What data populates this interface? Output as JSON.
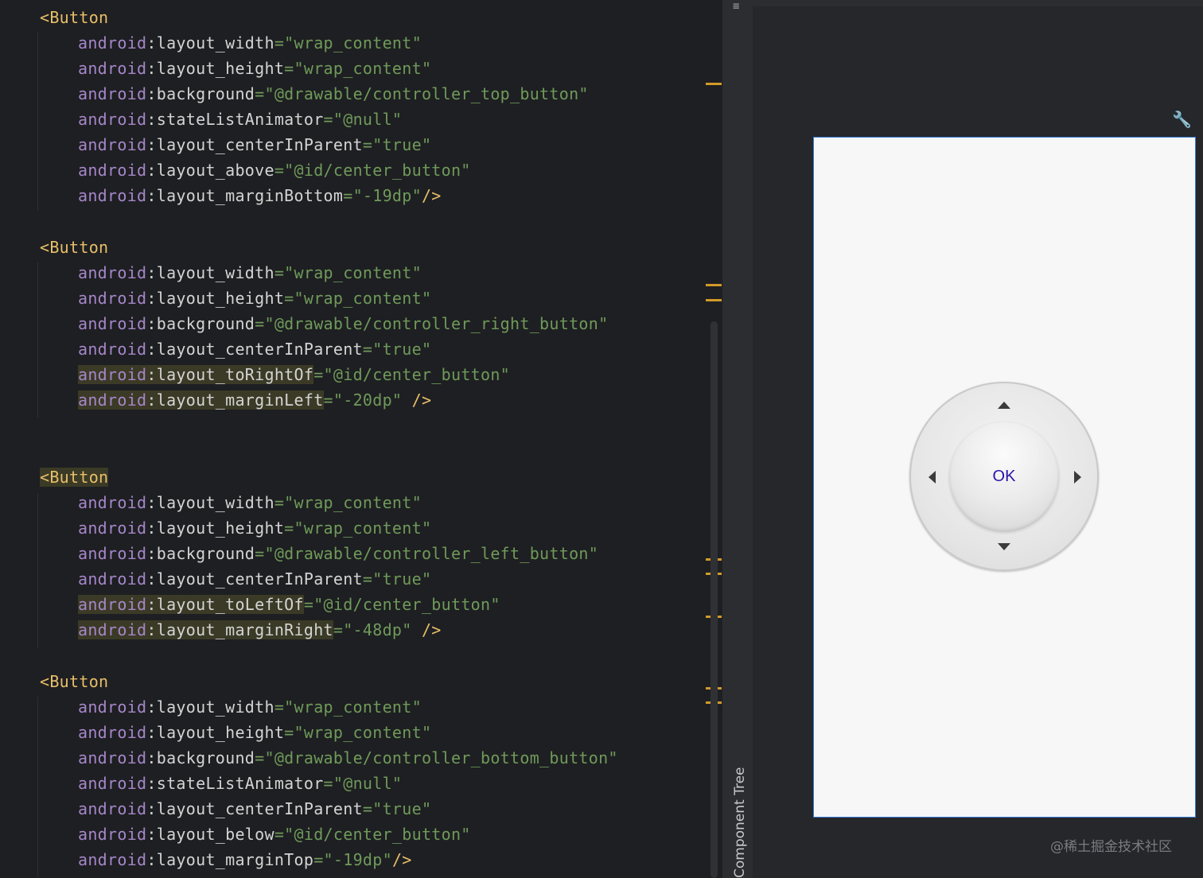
{
  "editor": {
    "lines": [
      {
        "tag": "<Button"
      },
      {
        "ns": "android",
        "attr": "layout_width",
        "val": "\"wrap_content\""
      },
      {
        "ns": "android",
        "attr": "layout_height",
        "val": "\"wrap_content\""
      },
      {
        "ns": "android",
        "attr": "background",
        "val": "\"@drawable/controller_top_button\""
      },
      {
        "ns": "android",
        "attr": "stateListAnimator",
        "val": "\"@null\""
      },
      {
        "ns": "android",
        "attr": "layout_centerInParent",
        "val": "\"true\""
      },
      {
        "ns": "android",
        "attr": "layout_above",
        "val": "\"@id/center_button\""
      },
      {
        "ns": "android",
        "attr": "layout_marginBottom",
        "val": "\"-19dp\"",
        "close": "/>"
      },
      {
        "tag": "<Button"
      },
      {
        "ns": "android",
        "attr": "layout_width",
        "val": "\"wrap_content\""
      },
      {
        "ns": "android",
        "attr": "layout_height",
        "val": "\"wrap_content\""
      },
      {
        "ns": "android",
        "attr": "background",
        "val": "\"@drawable/controller_right_button\""
      },
      {
        "ns": "android",
        "attr": "layout_centerInParent",
        "val": "\"true\""
      },
      {
        "ns": "android",
        "attr": "layout_toRightOf",
        "val": "\"@id/center_button\"",
        "highlight": true
      },
      {
        "ns": "android",
        "attr": "layout_marginLeft",
        "val": "\"-20dp\"",
        "close": " />",
        "highlight": true
      },
      {
        "tag": "<Button",
        "highlight": true
      },
      {
        "ns": "android",
        "attr": "layout_width",
        "val": "\"wrap_content\""
      },
      {
        "ns": "android",
        "attr": "layout_height",
        "val": "\"wrap_content\""
      },
      {
        "ns": "android",
        "attr": "background",
        "val": "\"@drawable/controller_left_button\""
      },
      {
        "ns": "android",
        "attr": "layout_centerInParent",
        "val": "\"true\""
      },
      {
        "ns": "android",
        "attr": "layout_toLeftOf",
        "val": "\"@id/center_button\"",
        "highlight": true
      },
      {
        "ns": "android",
        "attr": "layout_marginRight",
        "val": "\"-48dp\"",
        "close": " />",
        "highlight": true
      },
      {
        "tag": "<Button"
      },
      {
        "ns": "android",
        "attr": "layout_width",
        "val": "\"wrap_content\""
      },
      {
        "ns": "android",
        "attr": "layout_height",
        "val": "\"wrap_content\""
      },
      {
        "ns": "android",
        "attr": "background",
        "val": "\"@drawable/controller_bottom_button\""
      },
      {
        "ns": "android",
        "attr": "stateListAnimator",
        "val": "\"@null\""
      },
      {
        "ns": "android",
        "attr": "layout_centerInParent",
        "val": "\"true\""
      },
      {
        "ns": "android",
        "attr": "layout_below",
        "val": "\"@id/center_button\""
      },
      {
        "ns": "android",
        "attr": "layout_marginTop",
        "val": "\"-19dp\"",
        "close": "/>"
      }
    ]
  },
  "side_panel": {
    "label": "Component Tree"
  },
  "preview": {
    "ok_label": "OK",
    "watermark": "@稀土掘金技术社区"
  },
  "colors": {
    "tag": "#e8bf6a",
    "namespace": "#a686c9",
    "value": "#6f9a5a",
    "marker": "#d19a2a",
    "ok_text": "#2a13a8"
  },
  "icons": [
    "wrench-icon",
    "arrow-up-icon",
    "arrow-down-icon",
    "arrow-left-icon",
    "arrow-right-icon",
    "drag-handle-icon"
  ]
}
